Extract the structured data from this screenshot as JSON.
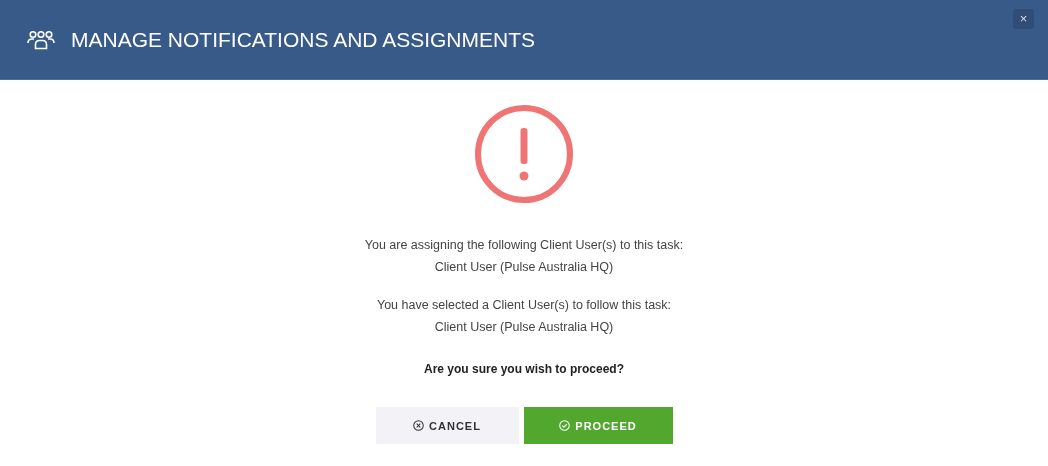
{
  "window": {
    "title": "MANAGE NOTIFICATIONS AND ASSIGNMENTS",
    "close": "×"
  },
  "messages": [
    {
      "lines": [
        "You are assigning the following Client User(s) to this task:",
        "Client User (Pulse Australia HQ)"
      ]
    },
    {
      "lines": [
        "You have selected a Client User(s) to follow this task:",
        "Client User (Pulse Australia HQ)"
      ]
    }
  ],
  "question": "Are you sure you wish to proceed?",
  "buttons": [
    {
      "label": "CANCEL",
      "kind": "cancel"
    },
    {
      "label": "PROCEED",
      "kind": "confirm"
    }
  ]
}
